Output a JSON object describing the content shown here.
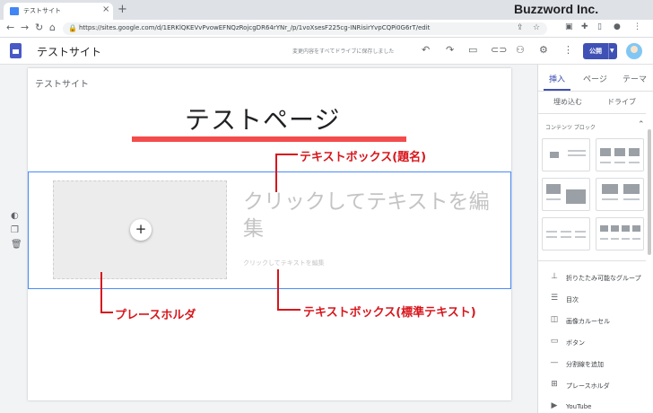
{
  "browser": {
    "tab_title": "テストサイト",
    "tab_close_icon": "close-icon",
    "url": "https://sites.google.com/d/1ERKlQKEVvPvowEFNQzRojcgDR64rYNr_/p/1voXsesF225cg-INRisirYvpCQPi0G6rT/edit",
    "brand": "Buzzword Inc."
  },
  "sites_toolbar": {
    "site_name": "テストサイト",
    "autosave": "変更内容をすべてドライブに保存しました",
    "publish_label": "公開"
  },
  "canvas": {
    "site_label": "テストサイト",
    "page_title": "テストページ",
    "heading_placeholder": "クリックしてテキストを編集",
    "body_placeholder": "クリックしてテキストを編集",
    "add_symbol": "+"
  },
  "annotations": {
    "title_box": "テキストボックス(題名)",
    "body_box": "テキストボックス(標準テキスト)",
    "placeholder": "プレースホルダ"
  },
  "panel": {
    "tabs": [
      "挿入",
      "ページ",
      "テーマ"
    ],
    "active_tab": "挿入",
    "insert_items": [
      "埋め込む",
      "ドライブ"
    ],
    "layouts_title": "コンテンツ ブロック",
    "list": [
      {
        "icon": "collapsible-group-icon",
        "label": "折りたたみ可能なグループ"
      },
      {
        "icon": "table-of-contents-icon",
        "label": "目次"
      },
      {
        "icon": "image-carousel-icon",
        "label": "画像カルーセル"
      },
      {
        "icon": "button-icon",
        "label": "ボタン"
      },
      {
        "icon": "divider-icon",
        "label": "分割線を追加"
      },
      {
        "icon": "placeholder-icon",
        "label": "プレースホルダ"
      },
      {
        "icon": "youtube-icon",
        "label": "YouTube"
      }
    ]
  },
  "colors": {
    "accent": "#3f51b5",
    "annotation": "#d7161c",
    "selection": "#4a8cf7"
  }
}
